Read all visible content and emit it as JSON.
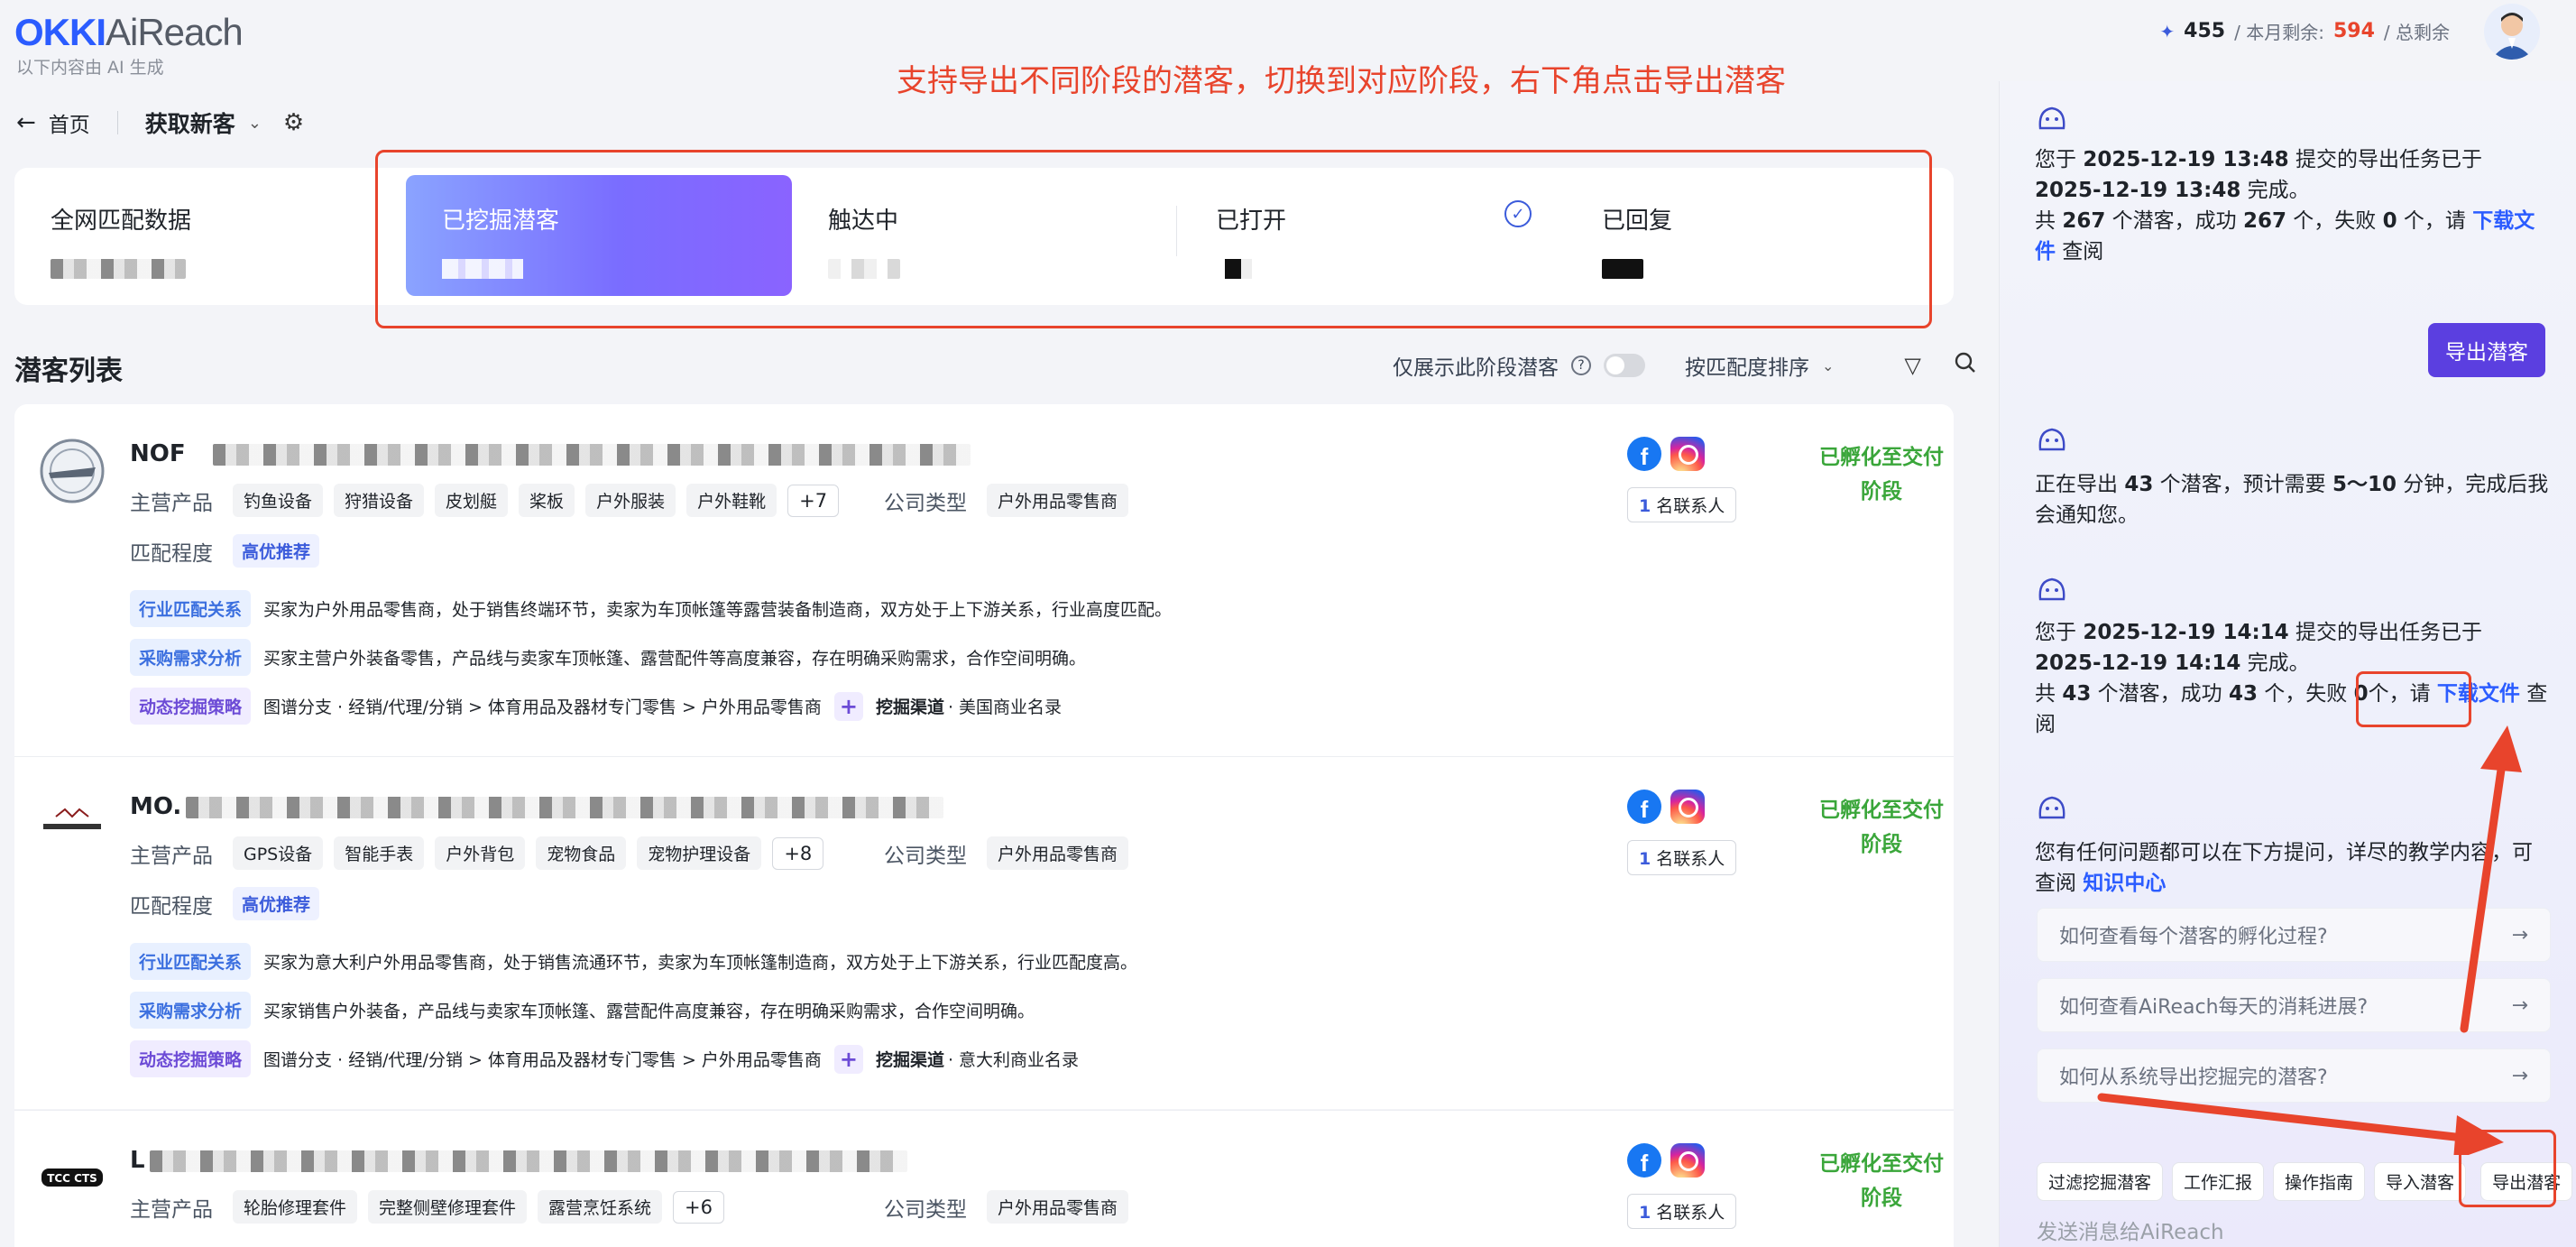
{
  "header": {
    "logo_a": "OKKI",
    "logo_b": "AiReach",
    "logo_sub": "以下内容由 AI 生成",
    "annotation": "支持导出不同阶段的潜客，切换到对应阶段，右下角点击导出潜客",
    "credits_value": "455",
    "credits_label": "/ 本月剩余:",
    "credits_remaining": "594",
    "credits_total_label": "/ 总剩余"
  },
  "breadcrumb": {
    "back": "←",
    "home": "首页",
    "title": "获取新客"
  },
  "stages": [
    {
      "label": "全网匹配数据"
    },
    {
      "label": "已挖掘潜客"
    },
    {
      "label": "触达中"
    },
    {
      "label": "已打开"
    },
    {
      "label": "已回复"
    }
  ],
  "list": {
    "title": "潜客列表",
    "only_stage": "仅展示此阶段潜客",
    "sort": "按匹配度排序"
  },
  "cards": [
    {
      "name": "NOF",
      "products_label": "主营产品",
      "products": [
        "钓鱼设备",
        "狩猎设备",
        "皮划艇",
        "桨板",
        "户外服装",
        "户外鞋靴"
      ],
      "more": "+7",
      "company_type_label": "公司类型",
      "company_type": "户外用品零售商",
      "match_label": "匹配程度",
      "match": "高优推荐",
      "industry_key": "行业匹配关系",
      "industry_text": "买家为户外用品零售商，处于销售终端环节，卖家为车顶帐篷等露营装备制造商，双方处于上下游关系，行业高度匹配。",
      "purchase_key": "采购需求分析",
      "purchase_text": "买家主营户外装备零售，产品线与卖家车顶帐篷、露营配件等高度兼容，存在明确采购需求，合作空间明确。",
      "strategy_key": "动态挖掘策略",
      "strategy_text": "图谱分支 · 经销/代理/分销 > 体育用品及器材专门零售 > 户外用品零售商",
      "channel_key": "挖掘渠道",
      "channel_text": "· 美国商业名录",
      "contacts_num": "1",
      "contacts_label": "名联系人",
      "status": "已孵化至交付阶段"
    },
    {
      "name": "MO.",
      "products_label": "主营产品",
      "products": [
        "GPS设备",
        "智能手表",
        "户外背包",
        "宠物食品",
        "宠物护理设备"
      ],
      "more": "+8",
      "company_type_label": "公司类型",
      "company_type": "户外用品零售商",
      "match_label": "匹配程度",
      "match": "高优推荐",
      "industry_key": "行业匹配关系",
      "industry_text": "买家为意大利户外用品零售商，处于销售流通环节，卖家为车顶帐篷制造商，双方处于上下游关系，行业匹配度高。",
      "purchase_key": "采购需求分析",
      "purchase_text": "买家销售户外装备，产品线与卖家车顶帐篷、露营配件高度兼容，存在明确采购需求，合作空间明确。",
      "strategy_key": "动态挖掘策略",
      "strategy_text": "图谱分支 · 经销/代理/分销 > 体育用品及器材专门零售 > 户外用品零售商",
      "channel_key": "挖掘渠道",
      "channel_text": "· 意大利商业名录",
      "contacts_num": "1",
      "contacts_label": "名联系人",
      "status": "已孵化至交付阶段"
    },
    {
      "name": "L",
      "products_label": "主营产品",
      "products": [
        "轮胎修理套件",
        "完整侧壁修理套件",
        "露营烹饪系统"
      ],
      "more": "+6",
      "company_type_label": "公司类型",
      "company_type": "户外用品零售商",
      "contacts_num": "1",
      "contacts_label": "名联系人",
      "status": "已孵化至交付阶段"
    }
  ],
  "panel": {
    "m1_a": "您于 ",
    "m1_t1": "2025-12-19 13:48",
    "m1_b": " 提交的导出任务已于 ",
    "m1_t2": "2025-12-19 13:48",
    "m1_c": " 完成。",
    "m1_d": "共 ",
    "m1_n1": "267",
    "m1_e": " 个潜客，成功 ",
    "m1_n2": "267",
    "m1_f": " 个，失败 ",
    "m1_n3": "0",
    "m1_g": " 个，请 ",
    "m1_link": "下载文件",
    "m1_h": " 查阅",
    "export_btn": "导出潜客",
    "m2_a": "正在导出 ",
    "m2_n": "43",
    "m2_b": " 个潜客，预计需要 ",
    "m2_t": "5～10",
    "m2_c": " 分钟，完成后我会通知您。",
    "m3_a": "您于 ",
    "m3_t1": "2025-12-19 14:14",
    "m3_b": " 提交的导出任务已于 ",
    "m3_t2": "2025-12-19 14:14",
    "m3_c": " 完成。",
    "m3_d": "共 ",
    "m3_n1": "43",
    "m3_e": " 个潜客，成功 ",
    "m3_n2": "43",
    "m3_f": " 个，失败 ",
    "m3_n3": "0",
    "m3_g": "个，请 ",
    "m3_link": "下载文件",
    "m3_h": " 查阅",
    "m4_a": "您有任何问题都可以在下方提问，详尽的教学内容，可查阅 ",
    "m4_link": "知识中心",
    "faqs": [
      "如何查看每个潜客的孵化过程?",
      "如何查看AiReach每天的消耗进展?",
      "如何从系统导出挖掘完的潜客?"
    ],
    "quick": [
      "过滤挖掘潜客",
      "工作汇报",
      "操作指南",
      "导入潜客",
      "导出潜客"
    ],
    "input_placeholder": "发送消息给AiReach"
  },
  "colors": {
    "accent": "#5b3fe0",
    "annotation": "#e8442c",
    "status": "#3aa63a",
    "link": "#2b5cff"
  }
}
